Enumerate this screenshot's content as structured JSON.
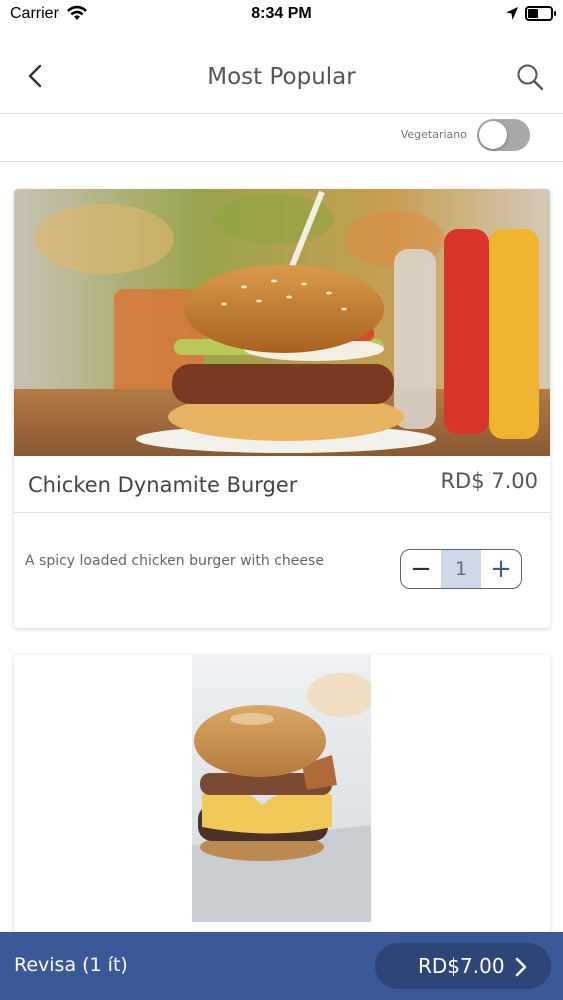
{
  "status_bar": {
    "carrier": "Carrier",
    "time": "8:34 PM",
    "battery_level": 0.45
  },
  "nav": {
    "title": "Most Popular",
    "back_icon": "chevron-left-icon",
    "search_icon": "search-icon"
  },
  "filter": {
    "vegetarian_label": "Vegetariano",
    "vegetarian_on": false
  },
  "items": [
    {
      "name": "Chicken Dynamite Burger",
      "price": "RD$ 7.00",
      "description": "A spicy loaded chicken burger with cheese",
      "quantity": "1",
      "minus_symbol": "−",
      "plus_symbol": "+"
    }
  ],
  "cart": {
    "label": "Revisa (1 ít)",
    "total": "RD$7.00",
    "button_color": "#2d4677",
    "bar_color": "#3b5998"
  }
}
